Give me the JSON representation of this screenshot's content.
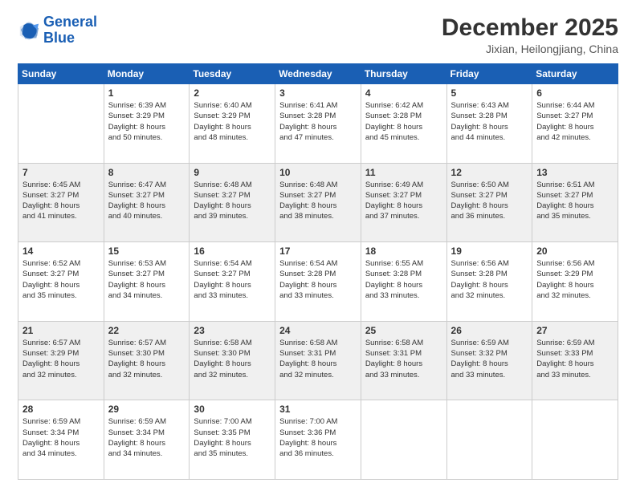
{
  "header": {
    "logo_general": "General",
    "logo_blue": "Blue",
    "title": "December 2025",
    "subtitle": "Jixian, Heilongjiang, China"
  },
  "calendar": {
    "days_of_week": [
      "Sunday",
      "Monday",
      "Tuesday",
      "Wednesday",
      "Thursday",
      "Friday",
      "Saturday"
    ],
    "weeks": [
      [
        {
          "num": "",
          "info": ""
        },
        {
          "num": "1",
          "info": "Sunrise: 6:39 AM\nSunset: 3:29 PM\nDaylight: 8 hours\nand 50 minutes."
        },
        {
          "num": "2",
          "info": "Sunrise: 6:40 AM\nSunset: 3:29 PM\nDaylight: 8 hours\nand 48 minutes."
        },
        {
          "num": "3",
          "info": "Sunrise: 6:41 AM\nSunset: 3:28 PM\nDaylight: 8 hours\nand 47 minutes."
        },
        {
          "num": "4",
          "info": "Sunrise: 6:42 AM\nSunset: 3:28 PM\nDaylight: 8 hours\nand 45 minutes."
        },
        {
          "num": "5",
          "info": "Sunrise: 6:43 AM\nSunset: 3:28 PM\nDaylight: 8 hours\nand 44 minutes."
        },
        {
          "num": "6",
          "info": "Sunrise: 6:44 AM\nSunset: 3:27 PM\nDaylight: 8 hours\nand 42 minutes."
        }
      ],
      [
        {
          "num": "7",
          "info": "Sunrise: 6:45 AM\nSunset: 3:27 PM\nDaylight: 8 hours\nand 41 minutes."
        },
        {
          "num": "8",
          "info": "Sunrise: 6:47 AM\nSunset: 3:27 PM\nDaylight: 8 hours\nand 40 minutes."
        },
        {
          "num": "9",
          "info": "Sunrise: 6:48 AM\nSunset: 3:27 PM\nDaylight: 8 hours\nand 39 minutes."
        },
        {
          "num": "10",
          "info": "Sunrise: 6:48 AM\nSunset: 3:27 PM\nDaylight: 8 hours\nand 38 minutes."
        },
        {
          "num": "11",
          "info": "Sunrise: 6:49 AM\nSunset: 3:27 PM\nDaylight: 8 hours\nand 37 minutes."
        },
        {
          "num": "12",
          "info": "Sunrise: 6:50 AM\nSunset: 3:27 PM\nDaylight: 8 hours\nand 36 minutes."
        },
        {
          "num": "13",
          "info": "Sunrise: 6:51 AM\nSunset: 3:27 PM\nDaylight: 8 hours\nand 35 minutes."
        }
      ],
      [
        {
          "num": "14",
          "info": "Sunrise: 6:52 AM\nSunset: 3:27 PM\nDaylight: 8 hours\nand 35 minutes."
        },
        {
          "num": "15",
          "info": "Sunrise: 6:53 AM\nSunset: 3:27 PM\nDaylight: 8 hours\nand 34 minutes."
        },
        {
          "num": "16",
          "info": "Sunrise: 6:54 AM\nSunset: 3:27 PM\nDaylight: 8 hours\nand 33 minutes."
        },
        {
          "num": "17",
          "info": "Sunrise: 6:54 AM\nSunset: 3:28 PM\nDaylight: 8 hours\nand 33 minutes."
        },
        {
          "num": "18",
          "info": "Sunrise: 6:55 AM\nSunset: 3:28 PM\nDaylight: 8 hours\nand 33 minutes."
        },
        {
          "num": "19",
          "info": "Sunrise: 6:56 AM\nSunset: 3:28 PM\nDaylight: 8 hours\nand 32 minutes."
        },
        {
          "num": "20",
          "info": "Sunrise: 6:56 AM\nSunset: 3:29 PM\nDaylight: 8 hours\nand 32 minutes."
        }
      ],
      [
        {
          "num": "21",
          "info": "Sunrise: 6:57 AM\nSunset: 3:29 PM\nDaylight: 8 hours\nand 32 minutes."
        },
        {
          "num": "22",
          "info": "Sunrise: 6:57 AM\nSunset: 3:30 PM\nDaylight: 8 hours\nand 32 minutes."
        },
        {
          "num": "23",
          "info": "Sunrise: 6:58 AM\nSunset: 3:30 PM\nDaylight: 8 hours\nand 32 minutes."
        },
        {
          "num": "24",
          "info": "Sunrise: 6:58 AM\nSunset: 3:31 PM\nDaylight: 8 hours\nand 32 minutes."
        },
        {
          "num": "25",
          "info": "Sunrise: 6:58 AM\nSunset: 3:31 PM\nDaylight: 8 hours\nand 33 minutes."
        },
        {
          "num": "26",
          "info": "Sunrise: 6:59 AM\nSunset: 3:32 PM\nDaylight: 8 hours\nand 33 minutes."
        },
        {
          "num": "27",
          "info": "Sunrise: 6:59 AM\nSunset: 3:33 PM\nDaylight: 8 hours\nand 33 minutes."
        }
      ],
      [
        {
          "num": "28",
          "info": "Sunrise: 6:59 AM\nSunset: 3:34 PM\nDaylight: 8 hours\nand 34 minutes."
        },
        {
          "num": "29",
          "info": "Sunrise: 6:59 AM\nSunset: 3:34 PM\nDaylight: 8 hours\nand 34 minutes."
        },
        {
          "num": "30",
          "info": "Sunrise: 7:00 AM\nSunset: 3:35 PM\nDaylight: 8 hours\nand 35 minutes."
        },
        {
          "num": "31",
          "info": "Sunrise: 7:00 AM\nSunset: 3:36 PM\nDaylight: 8 hours\nand 36 minutes."
        },
        {
          "num": "",
          "info": ""
        },
        {
          "num": "",
          "info": ""
        },
        {
          "num": "",
          "info": ""
        }
      ]
    ]
  }
}
